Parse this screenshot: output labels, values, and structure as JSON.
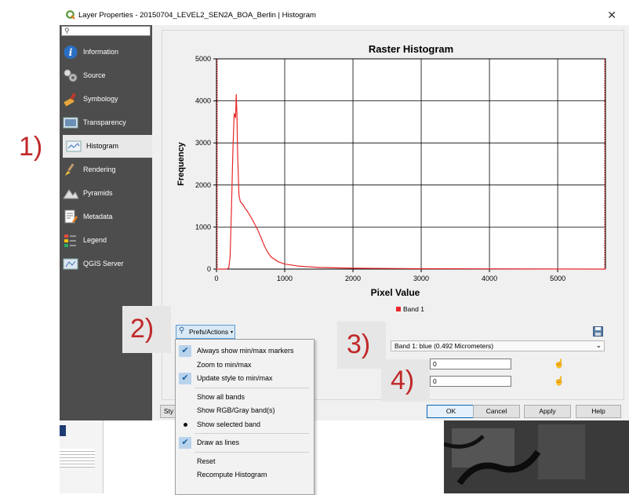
{
  "annotations": [
    "1)",
    "2)",
    "3)",
    "4)"
  ],
  "window": {
    "title": "Layer Properties - 20150704_LEVEL2_SEN2A_BOA_Berlin | Histogram",
    "close_glyph": "✕"
  },
  "sidebar": {
    "search_placeholder": "",
    "items": [
      {
        "label": "Information",
        "icon": "info-icon"
      },
      {
        "label": "Source",
        "icon": "source-icon"
      },
      {
        "label": "Symbology",
        "icon": "symbology-icon"
      },
      {
        "label": "Transparency",
        "icon": "transparency-icon"
      },
      {
        "label": "Histogram",
        "icon": "histogram-icon",
        "selected": true
      },
      {
        "label": "Rendering",
        "icon": "rendering-icon"
      },
      {
        "label": "Pyramids",
        "icon": "pyramids-icon"
      },
      {
        "label": "Metadata",
        "icon": "metadata-icon"
      },
      {
        "label": "Legend",
        "icon": "legend-icon"
      },
      {
        "label": "QGIS Server",
        "icon": "qgis-server-icon"
      }
    ]
  },
  "chart_data": {
    "type": "line",
    "title": "Raster Histogram",
    "xlabel": "Pixel Value",
    "ylabel": "Frequency",
    "xlim": [
      0,
      5700
    ],
    "ylim": [
      0,
      5000
    ],
    "x_ticks": [
      0,
      1000,
      2000,
      3000,
      4000,
      5000
    ],
    "y_ticks": [
      0,
      1000,
      2000,
      3000,
      4000,
      5000
    ],
    "grid": true,
    "legend_position": "bottom",
    "colors": {
      "series": "#e8282a",
      "minmax_marker": "#e8282a"
    },
    "minmax_markers": [
      0,
      5700
    ],
    "series": [
      {
        "name": "Band 1",
        "x": [
          0,
          150,
          180,
          200,
          220,
          240,
          260,
          280,
          290,
          300,
          310,
          330,
          350,
          380,
          400,
          430,
          450,
          480,
          500,
          550,
          600,
          650,
          700,
          750,
          800,
          900,
          1000,
          1200,
          1500,
          2000,
          3000,
          4000,
          5000,
          5700
        ],
        "y": [
          0,
          0,
          30,
          300,
          1400,
          2800,
          3700,
          3600,
          4150,
          3700,
          2700,
          1750,
          1600,
          1550,
          1500,
          1420,
          1380,
          1300,
          1250,
          1100,
          950,
          760,
          560,
          400,
          290,
          180,
          120,
          70,
          40,
          20,
          10,
          5,
          2,
          0
        ]
      }
    ]
  },
  "prefs": {
    "button_label": "Prefs/Actions",
    "menu": [
      {
        "label": "Always show min/max markers",
        "state": "checked"
      },
      {
        "label": "Zoom to min/max",
        "state": "none"
      },
      {
        "label": "Update style to min/max",
        "state": "checked"
      },
      {
        "separator": true
      },
      {
        "label": "Show all bands",
        "state": "none"
      },
      {
        "label": "Show RGB/Gray band(s)",
        "state": "none"
      },
      {
        "label": "Show selected band",
        "state": "radio"
      },
      {
        "separator": true
      },
      {
        "label": "Draw as lines",
        "state": "checked"
      },
      {
        "separator": true
      },
      {
        "label": "Reset",
        "state": "none"
      },
      {
        "label": "Recompute Histogram",
        "state": "none"
      }
    ]
  },
  "band": {
    "selected": "Band 1: blue (0.492 Micrometers)",
    "min_value": "0",
    "max_value": "0"
  },
  "footer": {
    "style_label": "Sty",
    "ok": "OK",
    "cancel": "Cancel",
    "apply": "Apply",
    "help": "Help"
  }
}
